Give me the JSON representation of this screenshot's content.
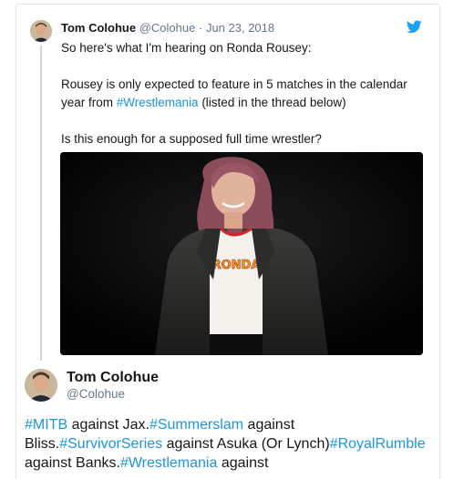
{
  "tweet1": {
    "name": "Tom Colohue",
    "handle": "@Colohue",
    "separator": "·",
    "date": "Jun 23, 2018",
    "line1": "So here's what I'm hearing on Ronda Rousey:",
    "line2_pre": "Rousey is only expected to feature in 5 matches in the calendar year from ",
    "line2_tag": "#Wrestlemania",
    "line2_post": " (listed in the thread below)",
    "line3": "Is this enough for a supposed full time wrestler?",
    "media_shirt_text": "RONDA"
  },
  "tweet2": {
    "name": "Tom Colohue",
    "handle": "@Colohue",
    "tag1": "#MITB",
    "text1": " against Jax.",
    "tag2": "#Summerslam",
    "text2": " against Bliss.",
    "tag3": "#SurvivorSeries",
    "text3": " against Asuka (Or Lynch)",
    "tag4": "#RoyalRumble",
    "text4": " against Banks.",
    "tag5": "#Wrestlemania",
    "text5": " against"
  },
  "icons": {
    "brand": "twitter-bird-icon"
  },
  "colors": {
    "hashtag": "#1b95e0",
    "brand": "#1da1f2",
    "muted": "#657786",
    "thread_line": "#ccd6dd"
  }
}
